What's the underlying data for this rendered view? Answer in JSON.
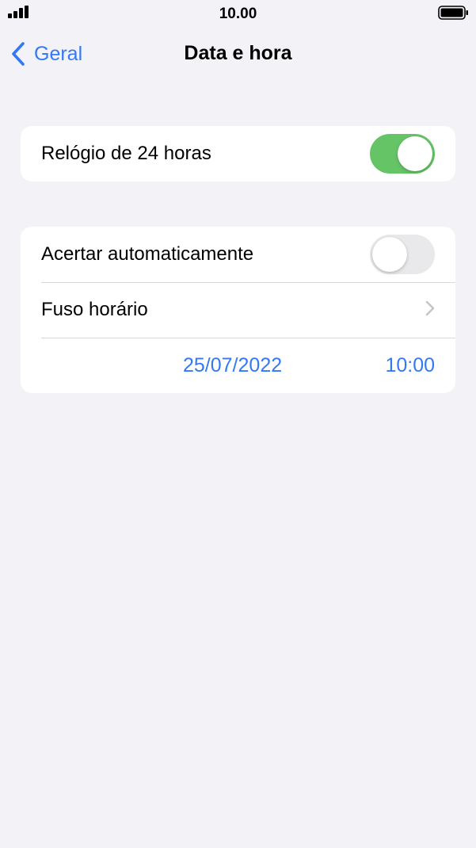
{
  "status_bar": {
    "time": "10.00"
  },
  "nav": {
    "back_label": "Geral",
    "title": "Data e hora"
  },
  "group1": {
    "clock24_label": "Relógio de 24 horas",
    "clock24_on": true
  },
  "group2": {
    "auto_label": "Acertar automaticamente",
    "auto_on": false,
    "timezone_label": "Fuso horário",
    "date": "25/07/2022",
    "time": "10:00"
  },
  "colors": {
    "accent": "#3478f6",
    "toggle_on": "#65c466",
    "toggle_off": "#e9e9eb",
    "background": "#f2f2f7"
  },
  "icons": {
    "signal": "cellular-signal-icon",
    "battery": "battery-icon",
    "back": "chevron-left-icon",
    "disclosure": "chevron-right-icon"
  }
}
